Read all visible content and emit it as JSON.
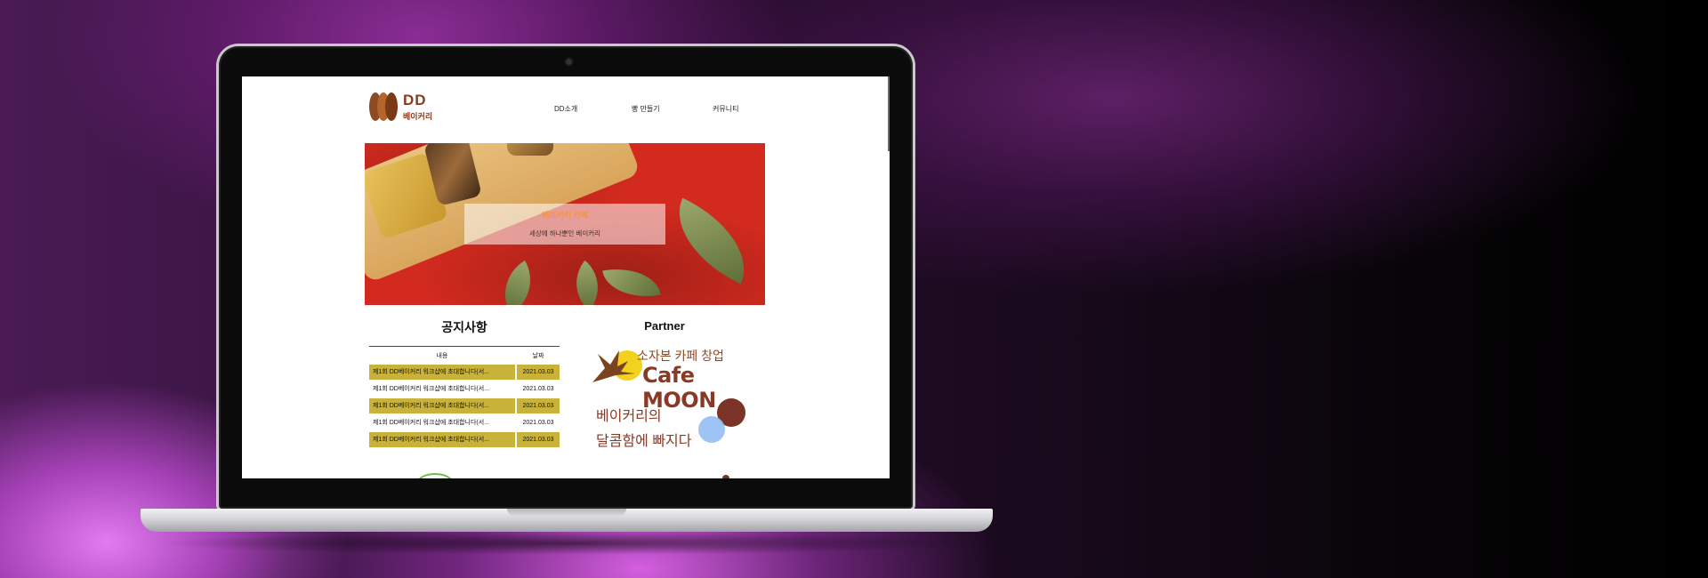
{
  "site": {
    "logo_text": "DD",
    "logo_sub": "베이커리"
  },
  "nav": {
    "items": [
      {
        "label": "DD소개"
      },
      {
        "label": "빵 만들기"
      },
      {
        "label": "커뮤니티"
      }
    ]
  },
  "hero": {
    "title": "베이커리 카페",
    "subtitle": "세상에 하나뿐인 베이커리"
  },
  "notice": {
    "title": "공지사항",
    "columns": [
      "내용",
      "날짜"
    ],
    "rows": [
      {
        "content": "제1회 DD베이커리 워크샵에 초대합니다(서...",
        "date": "2021.03.03",
        "highlight": true
      },
      {
        "content": "제1회 DD베이커리 워크샵에 초대합니다(서...",
        "date": "2021.03.03",
        "highlight": false
      },
      {
        "content": "제1회 DD베이커리 워크샵에 초대합니다(서...",
        "date": "2021.03.03",
        "highlight": true
      },
      {
        "content": "제1회 DD베이커리 워크샵에 초대합니다(서...",
        "date": "2021.03.03",
        "highlight": false
      },
      {
        "content": "제1회 DD베이커리 워크샵에 초대합니다(서...",
        "date": "2021.03.03",
        "highlight": true
      }
    ]
  },
  "partner": {
    "title": "Partner",
    "banner_line1": "소자본 카페 창업",
    "banner_brand": "Cafe MOON",
    "banner_line3": "베이커리의",
    "banner_line4": "달콤함에 빠지다"
  },
  "colors": {
    "highlight_row": "#c9b23a",
    "brand_brown": "#8b3a1a",
    "hero_red": "#d22a1e"
  }
}
